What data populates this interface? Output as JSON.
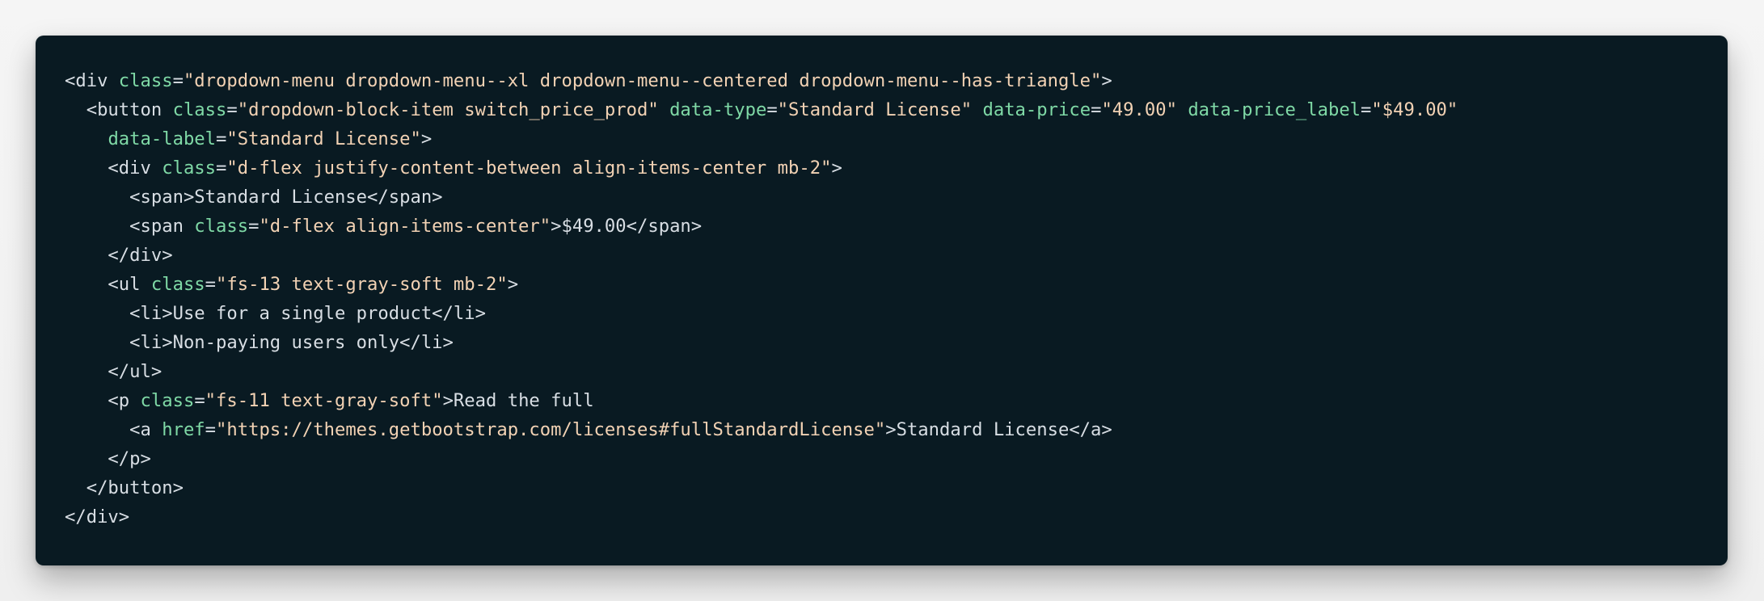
{
  "code_block": {
    "lines": [
      [
        {
          "t": "<div ",
          "c": "tag"
        },
        {
          "t": "class",
          "c": "attr"
        },
        {
          "t": "=",
          "c": "punct"
        },
        {
          "t": "\"dropdown-menu dropdown-menu--xl dropdown-menu--centered dropdown-menu--has-triangle\"",
          "c": "str"
        },
        {
          "t": ">",
          "c": "punct"
        }
      ],
      [
        {
          "t": "  <button ",
          "c": "tag"
        },
        {
          "t": "class",
          "c": "attr"
        },
        {
          "t": "=",
          "c": "punct"
        },
        {
          "t": "\"dropdown-block-item switch_price_prod\"",
          "c": "str"
        },
        {
          "t": " ",
          "c": "text"
        },
        {
          "t": "data-type",
          "c": "attr"
        },
        {
          "t": "=",
          "c": "punct"
        },
        {
          "t": "\"Standard License\"",
          "c": "str"
        },
        {
          "t": " ",
          "c": "text"
        },
        {
          "t": "data-price",
          "c": "attr"
        },
        {
          "t": "=",
          "c": "punct"
        },
        {
          "t": "\"49.00\"",
          "c": "str"
        },
        {
          "t": " ",
          "c": "text"
        },
        {
          "t": "data-price_label",
          "c": "attr"
        },
        {
          "t": "=",
          "c": "punct"
        },
        {
          "t": "\"$49.00\"",
          "c": "str"
        }
      ],
      [
        {
          "t": "    ",
          "c": "text"
        },
        {
          "t": "data-label",
          "c": "attr"
        },
        {
          "t": "=",
          "c": "punct"
        },
        {
          "t": "\"Standard License\"",
          "c": "str"
        },
        {
          "t": ">",
          "c": "punct"
        }
      ],
      [
        {
          "t": "    <div ",
          "c": "tag"
        },
        {
          "t": "class",
          "c": "attr"
        },
        {
          "t": "=",
          "c": "punct"
        },
        {
          "t": "\"d-flex justify-content-between align-items-center mb-2\"",
          "c": "str"
        },
        {
          "t": ">",
          "c": "punct"
        }
      ],
      [
        {
          "t": "      <span>Standard License</span>",
          "c": "text"
        }
      ],
      [
        {
          "t": "      <span ",
          "c": "tag"
        },
        {
          "t": "class",
          "c": "attr"
        },
        {
          "t": "=",
          "c": "punct"
        },
        {
          "t": "\"d-flex align-items-center\"",
          "c": "str"
        },
        {
          "t": ">$49.00</span>",
          "c": "text"
        }
      ],
      [
        {
          "t": "    </div>",
          "c": "tag"
        }
      ],
      [
        {
          "t": "    <ul ",
          "c": "tag"
        },
        {
          "t": "class",
          "c": "attr"
        },
        {
          "t": "=",
          "c": "punct"
        },
        {
          "t": "\"fs-13 text-gray-soft mb-2\"",
          "c": "str"
        },
        {
          "t": ">",
          "c": "punct"
        }
      ],
      [
        {
          "t": "      <li>Use for a single product</li>",
          "c": "text"
        }
      ],
      [
        {
          "t": "      <li>Non-paying users only</li>",
          "c": "text"
        }
      ],
      [
        {
          "t": "    </ul>",
          "c": "tag"
        }
      ],
      [
        {
          "t": "    <p ",
          "c": "tag"
        },
        {
          "t": "class",
          "c": "attr"
        },
        {
          "t": "=",
          "c": "punct"
        },
        {
          "t": "\"fs-11 text-gray-soft\"",
          "c": "str"
        },
        {
          "t": ">Read the full",
          "c": "text"
        }
      ],
      [
        {
          "t": "      <a ",
          "c": "tag"
        },
        {
          "t": "href",
          "c": "attr"
        },
        {
          "t": "=",
          "c": "punct"
        },
        {
          "t": "\"https://themes.getbootstrap.com/licenses#fullStandardLicense\"",
          "c": "str"
        },
        {
          "t": ">Standard License</a>",
          "c": "text"
        }
      ],
      [
        {
          "t": "    </p>",
          "c": "tag"
        }
      ],
      [
        {
          "t": "  </button>",
          "c": "tag"
        }
      ],
      [
        {
          "t": "</div>",
          "c": "tag"
        }
      ]
    ]
  },
  "colors": {
    "background": "#f2f2f2",
    "code_background": "#091a22",
    "attribute": "#7fd9a6",
    "string": "#f2d2b4",
    "text": "#d8dee4"
  }
}
